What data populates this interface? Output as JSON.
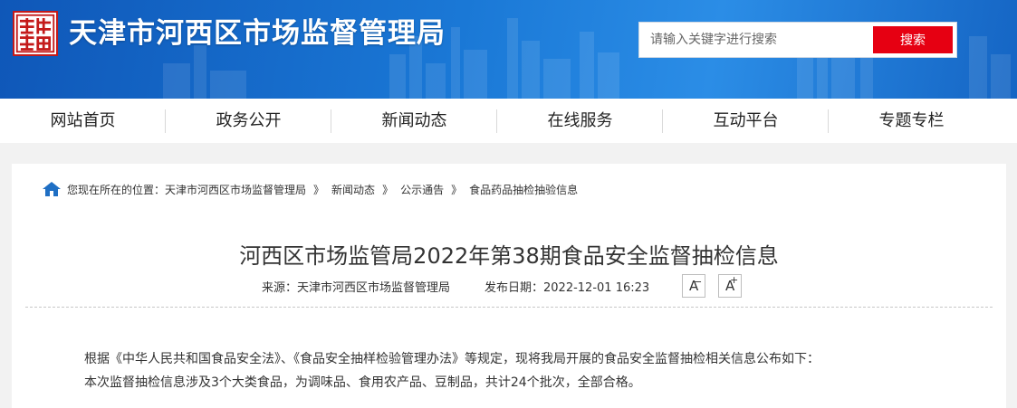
{
  "header": {
    "site_title": "天津市河西区市场监督管理局",
    "logo_text": "天津河西",
    "search_placeholder": "请输入关键字进行搜索",
    "search_button": "搜索",
    "colors": {
      "header_blue": "#1a78d6",
      "search_red": "#e60012",
      "logo_red": "#c41a1a"
    }
  },
  "nav": {
    "items": [
      "网站首页",
      "政务公开",
      "新闻动态",
      "在线服务",
      "互动平台",
      "专题专栏"
    ]
  },
  "breadcrumb": {
    "icon": "home-icon",
    "prefix": "您现在所在的位置：",
    "items": [
      "天津市河西区市场监督管理局",
      "新闻动态",
      "公示通告",
      "食品药品抽检抽验信息"
    ],
    "separator": "》"
  },
  "article": {
    "title": "河西区市场监管局2022年第38期食品安全监督抽检信息",
    "source": "来源：天津市河西区市场监督管理局",
    "date": "发布日期：2022-12-01 16:23",
    "font_decrease": "A",
    "font_increase": "A",
    "paragraphs": [
      "根据《中华人民共和国食品安全法》、《食品安全抽样检验管理办法》等规定，现将我局开展的食品安全监督抽检相关信息公布如下：",
      "本次监督抽检信息涉及3个大类食品，为调味品、食用农产品、豆制品，共计24个批次，全部合格。"
    ]
  }
}
